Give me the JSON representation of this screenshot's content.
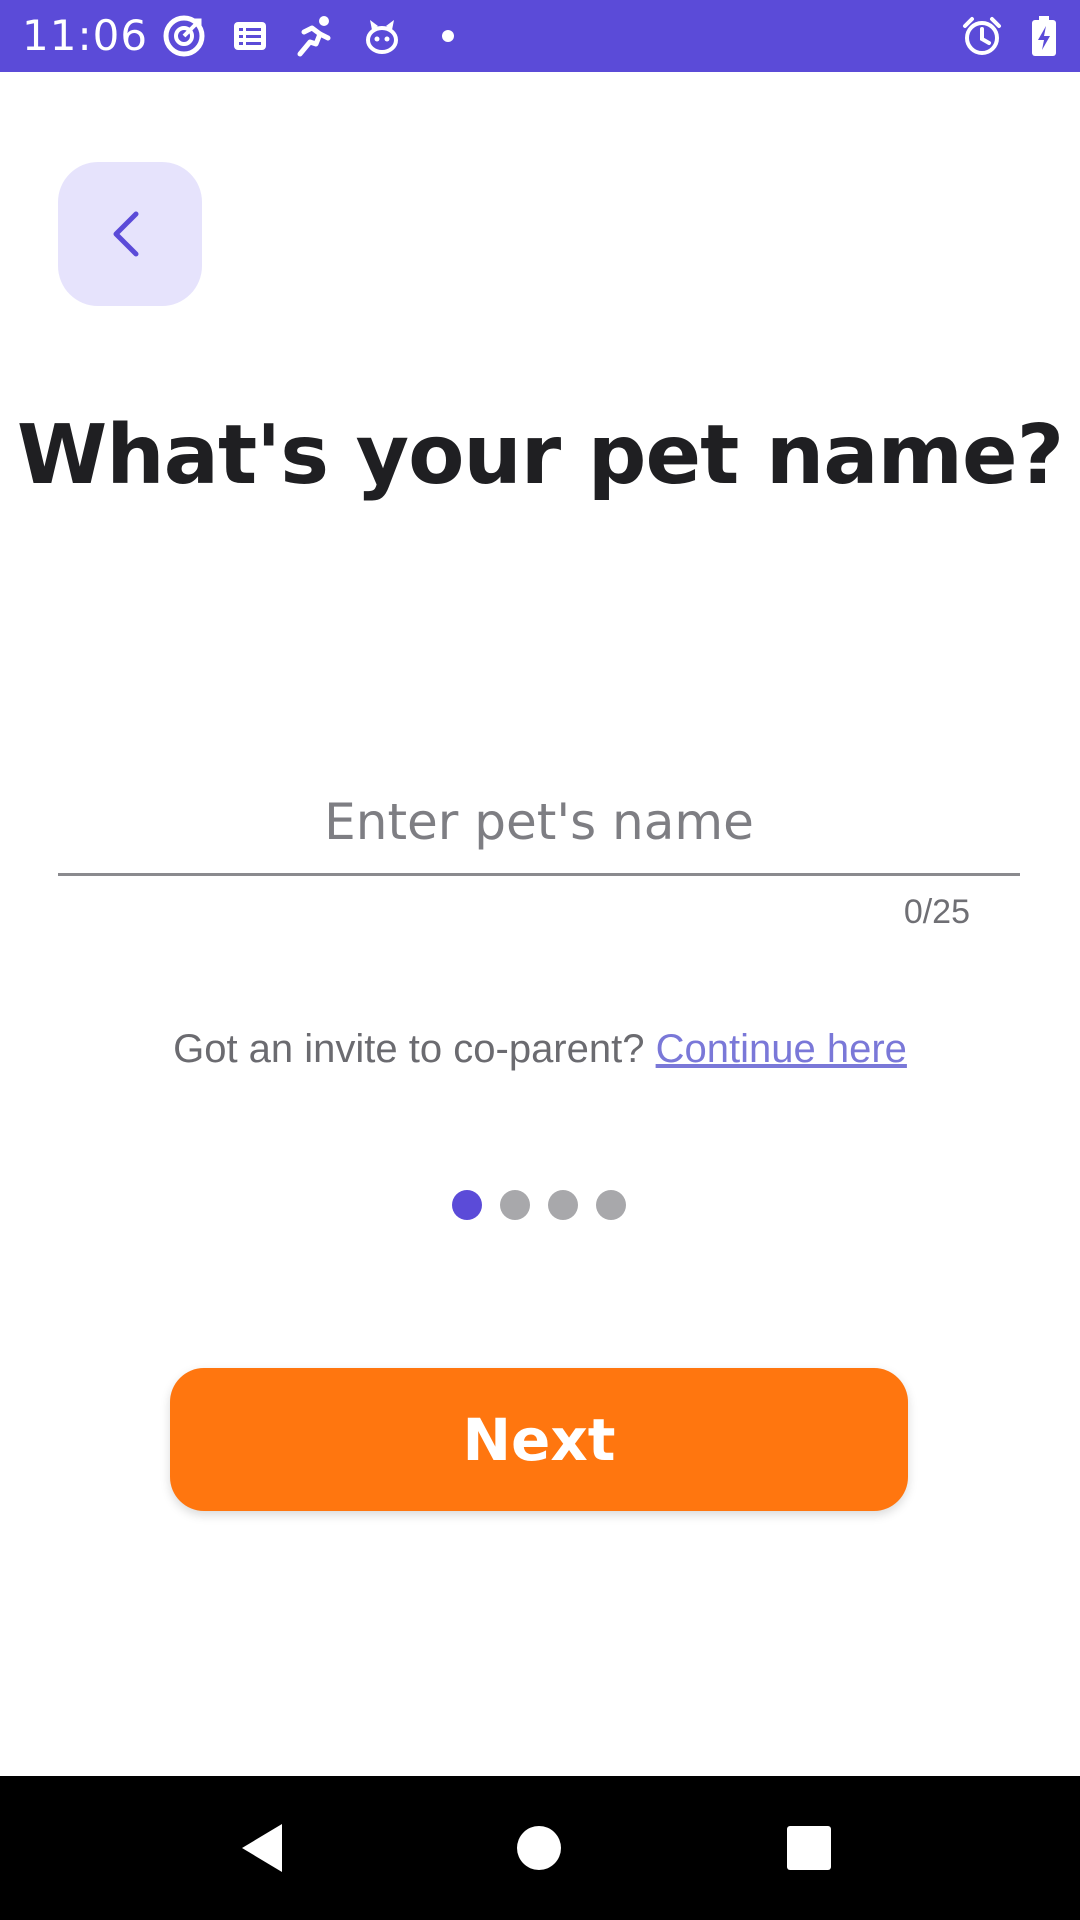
{
  "status_bar": {
    "time": "11:06",
    "icons_left": [
      "target-app-icon",
      "list-app-icon",
      "runner-app-icon",
      "pet-app-icon",
      "notification-dot-icon"
    ],
    "icons_right": [
      "alarm-icon",
      "battery-charging-icon"
    ],
    "background_color": "#5b4bd8"
  },
  "header": {
    "back_icon": "chevron-left-icon"
  },
  "main": {
    "title": "What's your pet name?",
    "name_input": {
      "value": "",
      "placeholder": "Enter pet's name"
    },
    "char_counter": "0/25",
    "invite_prompt": "Got an invite to co-parent?",
    "invite_link": "Continue here"
  },
  "pagination": {
    "total": 4,
    "current": 1
  },
  "footer": {
    "next_label": "Next",
    "next_color": "#ff760f"
  },
  "nav_bar": {
    "buttons": [
      "back-triangle-icon",
      "home-circle-icon",
      "recents-square-icon"
    ]
  }
}
